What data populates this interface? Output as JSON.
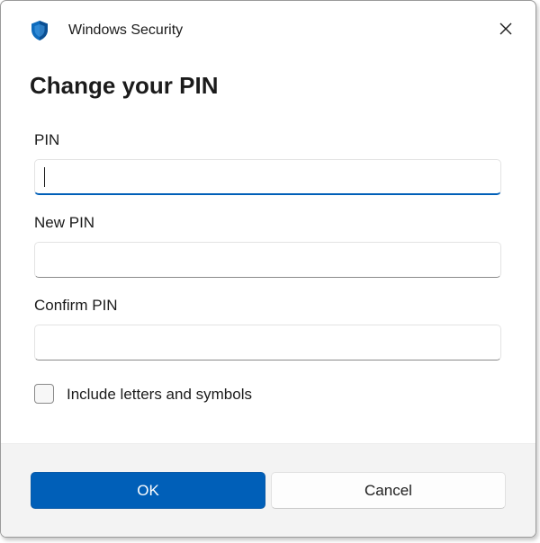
{
  "window": {
    "title": "Windows Security",
    "app_icon": "shield-icon",
    "close_icon": "close-icon"
  },
  "dialog": {
    "heading": "Change your PIN"
  },
  "fields": {
    "pin": {
      "label": "PIN",
      "value": "",
      "placeholder": ""
    },
    "new_pin": {
      "label": "New PIN",
      "value": "",
      "placeholder": ""
    },
    "confirm_pin": {
      "label": "Confirm PIN",
      "value": "",
      "placeholder": ""
    }
  },
  "options": {
    "include_letters_label": "Include letters and symbols",
    "include_letters_checked": false
  },
  "buttons": {
    "ok_label": "OK",
    "cancel_label": "Cancel"
  },
  "colors": {
    "accent": "#005fb8",
    "footer_bg": "#f3f3f3",
    "text": "#1b1b1b"
  }
}
